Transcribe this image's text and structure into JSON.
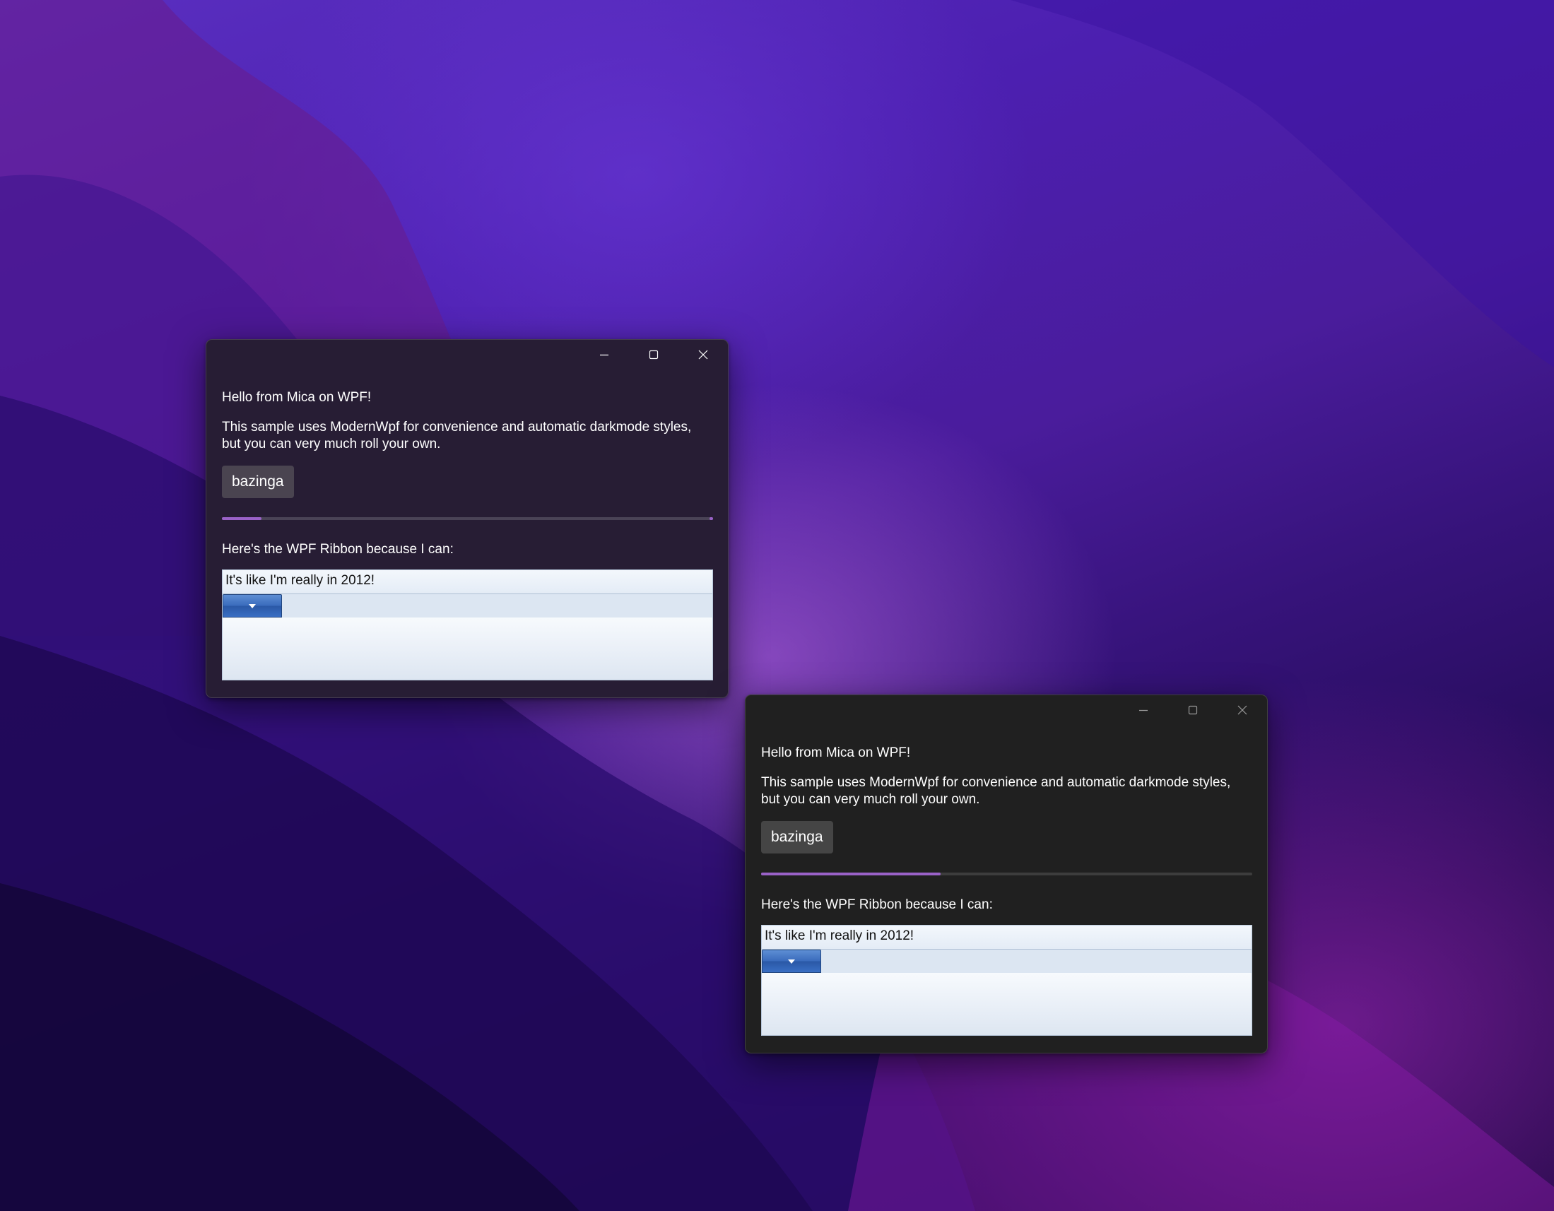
{
  "windows": [
    {
      "id": "window-mica",
      "hello_text": "Hello from Mica on WPF!",
      "description": "This sample uses ModernWpf for convenience and automatic darkmode styles, but you can very much roll your own.",
      "button_label": "bazinga",
      "progress_fraction": 0.08,
      "ribbon_heading": "Here's the WPF Ribbon because I can:",
      "ribbon_title": "It's like I'm really in 2012!",
      "background_color": "#271d34",
      "caption_buttons": [
        "minimize-icon",
        "maximize-icon",
        "close-icon"
      ]
    },
    {
      "id": "window-dark",
      "hello_text": "Hello from Mica on WPF!",
      "description": "This sample uses ModernWpf for convenience and automatic darkmode styles, but you can very much roll your own.",
      "button_label": "bazinga",
      "progress_fraction": 0.365,
      "ribbon_heading": "Here's the WPF Ribbon because I can:",
      "ribbon_title": "It's like I'm really in 2012!",
      "background_color": "#202020",
      "caption_buttons": [
        "minimize-icon",
        "maximize-icon",
        "close-icon"
      ]
    }
  ],
  "colors": {
    "accent": "#9a62c8",
    "ribbon_app_button": "#3b6cbd",
    "desktop": "#4a1c9c"
  }
}
